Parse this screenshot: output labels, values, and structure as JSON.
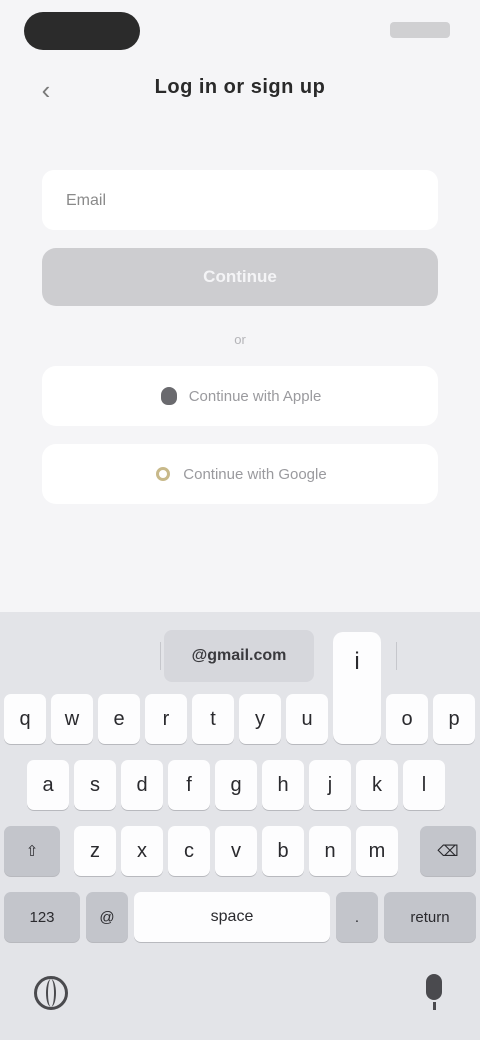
{
  "status_bar": {},
  "header": {
    "back_icon": "chevron-left-icon",
    "back_glyph": "‹",
    "title": "Log in or sign up"
  },
  "form": {
    "email_placeholder": "Email",
    "continue_label": "Continue",
    "divider": "or"
  },
  "social": {
    "apple_label": "Continue with Apple",
    "google_label": "Continue with Google"
  },
  "keyboard": {
    "suggestions": [
      "",
      "@gmail.com",
      ""
    ],
    "row1": [
      "q",
      "w",
      "e",
      "r",
      "t",
      "y",
      "u",
      "i",
      "o",
      "p"
    ],
    "row2": [
      "a",
      "s",
      "d",
      "f",
      "g",
      "h",
      "j",
      "k",
      "l"
    ],
    "row3": [
      "z",
      "x",
      "c",
      "v",
      "b",
      "n",
      "m"
    ],
    "shift": "⇧",
    "delete": "⌫",
    "numbers": "123",
    "space": "space",
    "at": "@",
    "dot": ".",
    "return": "return",
    "popup_key": "i"
  },
  "colors": {
    "background": "#f5f5f7",
    "keyboard": "#e3e4e8",
    "button_disabled": "#cdcdd0"
  }
}
